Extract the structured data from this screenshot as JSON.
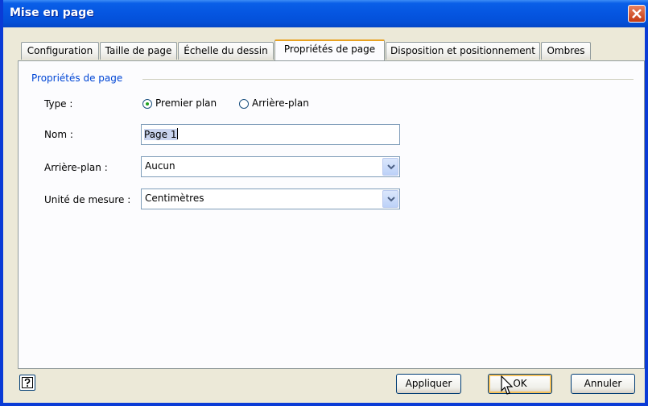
{
  "window": {
    "title": "Mise en page"
  },
  "tabs": [
    {
      "label": "Configuration",
      "active": false
    },
    {
      "label": "Taille de page",
      "active": false
    },
    {
      "label": "Échelle du dessin",
      "active": false
    },
    {
      "label": "Propriétés de page",
      "active": true
    },
    {
      "label": "Disposition et positionnement",
      "active": false
    },
    {
      "label": "Ombres",
      "active": false
    }
  ],
  "group": {
    "label": "Propriétés de page"
  },
  "type": {
    "label": "Type :",
    "options": [
      {
        "label": "Premier plan",
        "checked": true
      },
      {
        "label": "Arrière-plan",
        "checked": false
      }
    ]
  },
  "name": {
    "label": "Nom :",
    "value": "Page 1"
  },
  "background": {
    "label": "Arrière-plan :",
    "value": "Aucun"
  },
  "unit": {
    "label": "Unité de mesure :",
    "value": "Centimètres"
  },
  "buttons": {
    "apply": "Appliquer",
    "ok": "OK",
    "cancel": "Annuler"
  },
  "colors": {
    "title_bar": "#0555e0",
    "close": "#c43a14",
    "group_label": "#0046d5",
    "active_tab_accent": "#e8a222"
  }
}
